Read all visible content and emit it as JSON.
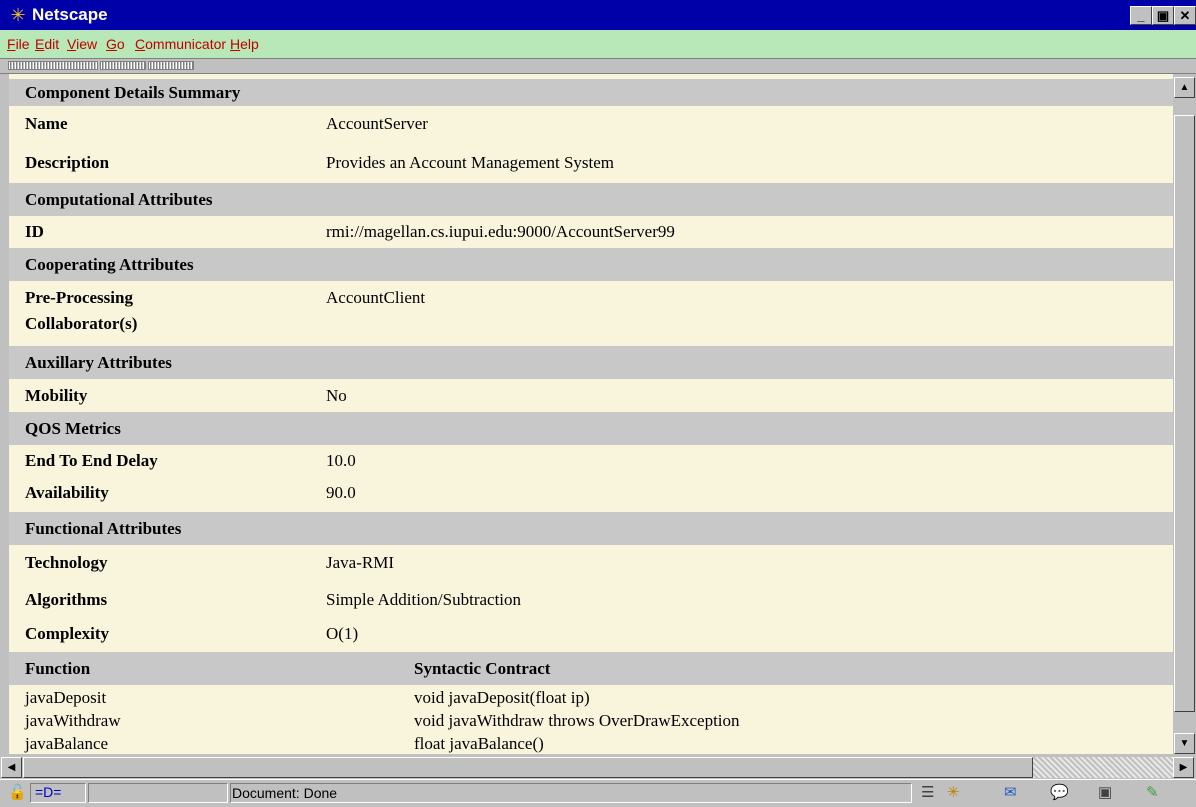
{
  "window": {
    "title": "Netscape",
    "minimize": "_",
    "maximize": "▣",
    "close": "✕"
  },
  "menu": [
    "File",
    "Edit",
    "View",
    "Go",
    "Communicator",
    "Help"
  ],
  "details": {
    "summary_header": "Component Details Summary",
    "name_label": "Name",
    "name_value": "AccountServer",
    "description_label": "Description",
    "description_value": "Provides an Account Management System",
    "computational_header": "Computational Attributes",
    "id_label": "ID",
    "id_value": "rmi://magellan.cs.iupui.edu:9000/AccountServer99",
    "cooperating_header": "Cooperating Attributes",
    "preprocessing_label_1": "Pre-Processing",
    "preprocessing_label_2": "Collaborator(s)",
    "preprocessing_value": "AccountClient",
    "auxillary_header": "Auxillary Attributes",
    "mobility_label": "Mobility",
    "mobility_value": "No",
    "qos_header": "QOS Metrics",
    "delay_label": "End To End Delay",
    "delay_value": "10.0",
    "availability_label": "Availability",
    "availability_value": "90.0",
    "functional_header": "Functional Attributes",
    "technology_label": "Technology",
    "technology_value": "Java-RMI",
    "algorithms_label": "Algorithms",
    "algorithms_value": "Simple Addition/Subtraction",
    "complexity_label": "Complexity",
    "complexity_value": "O(1)"
  },
  "functions": {
    "col_function": "Function",
    "col_contract": "Syntactic Contract",
    "rows": [
      {
        "name": "javaDeposit",
        "contract": "void javaDeposit(float ip)"
      },
      {
        "name": "javaWithdraw",
        "contract": "void javaWithdraw throws OverDrawException"
      },
      {
        "name": "javaBalance",
        "contract": "float javaBalance()"
      }
    ]
  },
  "status": {
    "text": "Document: Done"
  }
}
